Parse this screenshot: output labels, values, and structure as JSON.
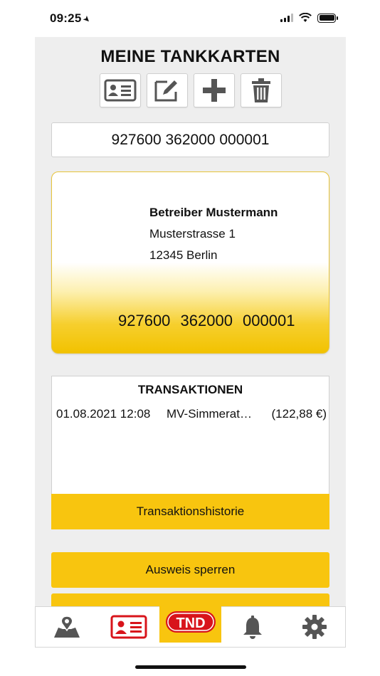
{
  "status": {
    "time": "09:25"
  },
  "page": {
    "title": "MEINE TANKKARTEN"
  },
  "toolbar": {
    "buttons": [
      {
        "icon": "id-card-icon"
      },
      {
        "icon": "edit-icon"
      },
      {
        "icon": "plus-icon"
      },
      {
        "icon": "trash-icon"
      }
    ]
  },
  "selector": {
    "value": "927600 362000 000001"
  },
  "card": {
    "holder": "Betreiber Mustermann",
    "street": "Musterstrasse 1",
    "city": "12345 Berlin",
    "number": "927600 362000 000001"
  },
  "transactions": {
    "title": "TRANSAKTIONEN",
    "items": [
      {
        "date": "01.08.2021 12:08",
        "description": "MV-Simmerat…",
        "amount": "(122,88 €)"
      }
    ],
    "history_label": "Transaktionshistorie"
  },
  "actions": {
    "block_label": "Ausweis sperren"
  },
  "tabbar": {
    "tnd_label": "TND",
    "tabs": [
      "map-icon",
      "id-card-icon",
      "tnd-logo",
      "bell-icon",
      "gear-icon"
    ]
  },
  "colors": {
    "accent": "#f8c50f",
    "active_tab": "#d8141b",
    "icon_gray": "#555555"
  }
}
